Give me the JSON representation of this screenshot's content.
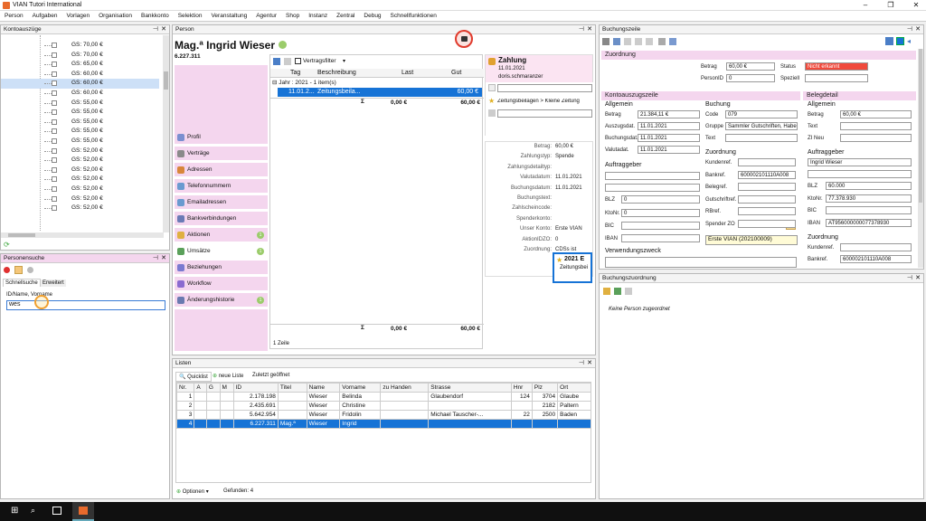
{
  "window": {
    "title": "VIAN Tutori International"
  },
  "menu": [
    "Person",
    "Aufgaben",
    "Vorlagen",
    "Organisation",
    "Bankkonto",
    "Selektion",
    "Veranstaltung",
    "Agentur",
    "Shop",
    "Instanz",
    "Zentral",
    "Debug",
    "Schnellfunktionen"
  ],
  "kontoauszuege": {
    "title": "Kontoauszüge",
    "items": [
      "GS: 70,00 €",
      "GS: 70,00 €",
      "GS: 65,00 €",
      "GS: 60,00 €",
      "GS: 60,00 €",
      "GS: 60,00 €",
      "GS: 55,00 €",
      "GS: 55,00 €",
      "GS: 55,00 €",
      "GS: 55,00 €",
      "GS: 55,00 €",
      "GS: 52,00 €",
      "GS: 52,00 €",
      "GS: 52,00 €",
      "GS: 52,00 €",
      "GS: 52,00 €",
      "GS: 52,00 €",
      "GS: 52,00 €"
    ],
    "selected_index": 4
  },
  "personensuche": {
    "title": "Personensuche",
    "tabs": [
      "Schnellsuche",
      "Erweitert"
    ],
    "field_label": "ID/Name, Vorname",
    "input_value": "wes"
  },
  "person": {
    "title": "Person",
    "name": "Mag.ª Ingrid Wieser",
    "id": "6.227.311",
    "nav": [
      {
        "label": "Profil",
        "badge": ""
      },
      {
        "label": "Verträge",
        "badge": ""
      },
      {
        "label": "Adressen",
        "badge": ""
      },
      {
        "label": "Telefonnummern",
        "badge": ""
      },
      {
        "label": "Emailadressen",
        "badge": ""
      },
      {
        "label": "Bankverbindungen",
        "badge": ""
      },
      {
        "label": "Aktionen",
        "badge": "1"
      },
      {
        "label": "Umsätze",
        "badge": "1"
      },
      {
        "label": "Beziehungen",
        "badge": ""
      },
      {
        "label": "Workflow",
        "badge": ""
      },
      {
        "label": "Änderungshistorie",
        "badge": "1"
      }
    ],
    "filter": "Vertragsfilter",
    "grid_headers": [
      "Tag",
      "Beschreibung",
      "Last",
      "Gut"
    ],
    "group_label": "Jahr : 2021 - 1 item(s)",
    "row": {
      "tag": "11.01.2...",
      "beschreibung": "Zeitungsbeila...",
      "last": "",
      "gut": "60,00 €"
    },
    "sum_symbol": "Σ",
    "sum_last": "0,00 €",
    "sum_gut": "60,00 €",
    "footer_sum_last": "0,00 €",
    "footer_sum_gut": "60,00 €",
    "footer_count": "1 Zeile",
    "zahlung": {
      "title": "Zahlung",
      "date": "11.01.2021",
      "user": "doris.schmaranzer",
      "breadcrumb": "Zeitungsbeilagen > Kleine Zeitung"
    },
    "details": [
      {
        "k": "Betrag:",
        "v": "60,00 €"
      },
      {
        "k": "Zahlungstyp:",
        "v": "Spende"
      },
      {
        "k": "Zahlungsdetailtyp:",
        "v": ""
      },
      {
        "k": "Valutadatum:",
        "v": "11.01.2021"
      },
      {
        "k": "Buchungsdatum:",
        "v": "11.01.2021"
      },
      {
        "k": "Buchungstext:",
        "v": ""
      },
      {
        "k": "Zahlscheincode:",
        "v": ""
      },
      {
        "k": "Spenderkonto:",
        "v": ""
      },
      {
        "k": "Unser Konto:",
        "v": "Erste VIAN"
      },
      {
        "k": "AktionIDZO:",
        "v": "0"
      },
      {
        "k": "Zuordnung:",
        "v": "CDSs ist"
      }
    ],
    "card": {
      "title": "2021 E",
      "sub": "Zeitungsbei"
    }
  },
  "buchungszeile": {
    "title": "Buchungszeile",
    "zuordnung": {
      "title": "Zuordnung",
      "betrag_label": "Betrag",
      "betrag": "60,00 €",
      "status_label": "Status",
      "status": "Nicht erkannt",
      "personid_label": "PersonID",
      "personid": "0",
      "speziell_label": "Speziell"
    },
    "konto": {
      "title": "Kontoauszugszeile",
      "allgemein": "Allgemein",
      "fields": [
        {
          "k": "Betrag",
          "v": "21.384,11 €"
        },
        {
          "k": "Auszugsdat.",
          "v": "11.01.2021"
        },
        {
          "k": "Buchungsdat.",
          "v": "11.01.2021"
        },
        {
          "k": "Valutadat.",
          "v": "11.01.2021"
        }
      ],
      "auftraggeber": "Auftraggeber",
      "blz_label": "BLZ",
      "blz": "0",
      "ktonr_label": "KtoNr.",
      "ktonr": "0",
      "bic_label": "BIC",
      "iban_label": "IBAN",
      "verwendungszweck": "Verwendungszweck"
    },
    "buchung": {
      "title": "Buchung",
      "fields": [
        {
          "k": "Code",
          "v": "079"
        },
        {
          "k": "Gruppe",
          "v": "Sammler Gutschriften, Haben"
        },
        {
          "k": "Text",
          "v": ""
        }
      ],
      "zuordnung": "Zuordnung",
      "zfields": [
        {
          "k": "Kundenref.",
          "v": ""
        },
        {
          "k": "Bankref.",
          "v": "600002101110A008"
        },
        {
          "k": "Belegref.",
          "v": ""
        },
        {
          "k": "Gutschriftref.",
          "v": ""
        },
        {
          "k": "RBref.",
          "v": ""
        },
        {
          "k": "Spender ZO",
          "v": ""
        }
      ],
      "konto_value": "Erste VIAN (202100009)"
    },
    "beleg": {
      "title": "Belegdetail",
      "allgemein": "Allgemein",
      "fields": [
        {
          "k": "Betrag",
          "v": "60,00 €"
        },
        {
          "k": "Text",
          "v": ""
        },
        {
          "k": "ZI Neu",
          "v": ""
        }
      ],
      "auftraggeber": "Auftraggeber",
      "name": "Ingrid Wieser",
      "bfields": [
        {
          "k": "BLZ",
          "v": "60.000"
        },
        {
          "k": "KtoNr.",
          "v": "77.378.930"
        },
        {
          "k": "BIC",
          "v": ""
        },
        {
          "k": "IBAN",
          "v": "AT956000000077378930"
        }
      ],
      "zuordnung": "Zuordnung",
      "zfields": [
        {
          "k": "Kundenref.",
          "v": ""
        },
        {
          "k": "Bankref.",
          "v": "600002101110A008"
        }
      ]
    }
  },
  "buchungszuordnung": {
    "title": "Buchungszuordnung",
    "empty": "Keine Person zugeordnet"
  },
  "listen": {
    "title": "Listen",
    "tabs": [
      "Quicklist",
      "neue Liste",
      "Zuletzt geöffnet"
    ],
    "headers": [
      "Nr.",
      "A",
      "G",
      "M",
      "ID",
      "Titel",
      "Name",
      "Vorname",
      "zu Handen",
      "Strasse",
      "Hnr",
      "Plz",
      "Ort"
    ],
    "rows": [
      [
        "1",
        "",
        "",
        "",
        "2.178.198",
        "",
        "Wieser",
        "Belinda",
        "",
        "Glaubendorf",
        "124",
        "3704",
        "Glaube"
      ],
      [
        "2",
        "",
        "",
        "",
        "2.435.691",
        "",
        "Wieser",
        "Christine",
        "",
        "",
        "",
        "2182",
        "Paltern"
      ],
      [
        "3",
        "",
        "",
        "",
        "5.642.954",
        "",
        "Wieser",
        "Fridolin",
        "",
        "Michael Tauscher-...",
        "22",
        "2500",
        "Baden"
      ],
      [
        "4",
        "",
        "",
        "",
        "6.227.311",
        "Mag.ª",
        "Wieser",
        "Ingrid",
        "",
        "",
        "",
        "",
        ""
      ]
    ],
    "selected": 3,
    "options": "Optionen",
    "found": "Gefunden: 4"
  },
  "colors": {
    "accent": "#1673d6",
    "pink": "#f4d6ee",
    "status_red": "#f04a3c"
  }
}
